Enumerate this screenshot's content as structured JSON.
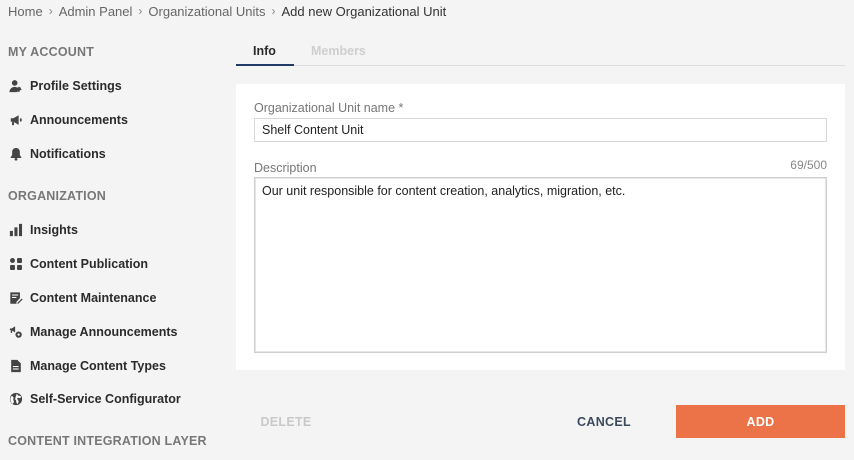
{
  "breadcrumb": {
    "items": [
      "Home",
      "Admin Panel",
      "Organizational Units"
    ],
    "current": "Add new Organizational Unit",
    "separator": "›"
  },
  "sidebar": {
    "my_account": {
      "title": "MY ACCOUNT",
      "items": [
        {
          "label": "Profile Settings",
          "icon": "profile-icon"
        },
        {
          "label": "Announcements",
          "icon": "megaphone-icon"
        },
        {
          "label": "Notifications",
          "icon": "bell-icon"
        }
      ]
    },
    "organization": {
      "title": "ORGANIZATION",
      "items": [
        {
          "label": "Insights",
          "icon": "bar-chart-icon"
        },
        {
          "label": "Content Publication",
          "icon": "grid-icon"
        },
        {
          "label": "Content Maintenance",
          "icon": "document-edit-icon"
        },
        {
          "label": "Manage Announcements",
          "icon": "megaphone-gear-icon"
        },
        {
          "label": "Manage Content Types",
          "icon": "file-icon"
        },
        {
          "label": "Self-Service Configurator",
          "icon": "globe-icon"
        }
      ]
    },
    "integration": {
      "title": "CONTENT INTEGRATION LAYER"
    }
  },
  "tabs": [
    {
      "label": "Info",
      "active": true
    },
    {
      "label": "Members",
      "active": false
    }
  ],
  "form": {
    "name_label": "Organizational Unit name *",
    "name_value": "Shelf Content Unit",
    "description_label": "Description",
    "description_counter": "69/500",
    "description_value": "Our unit responsible for content creation, analytics, migration, etc."
  },
  "actions": {
    "delete_label": "DELETE",
    "cancel_label": "CANCEL",
    "add_label": "ADD"
  },
  "colors": {
    "accent": "#ec7347",
    "tab_underline": "#1f3b66",
    "background": "#f4f4f4"
  }
}
